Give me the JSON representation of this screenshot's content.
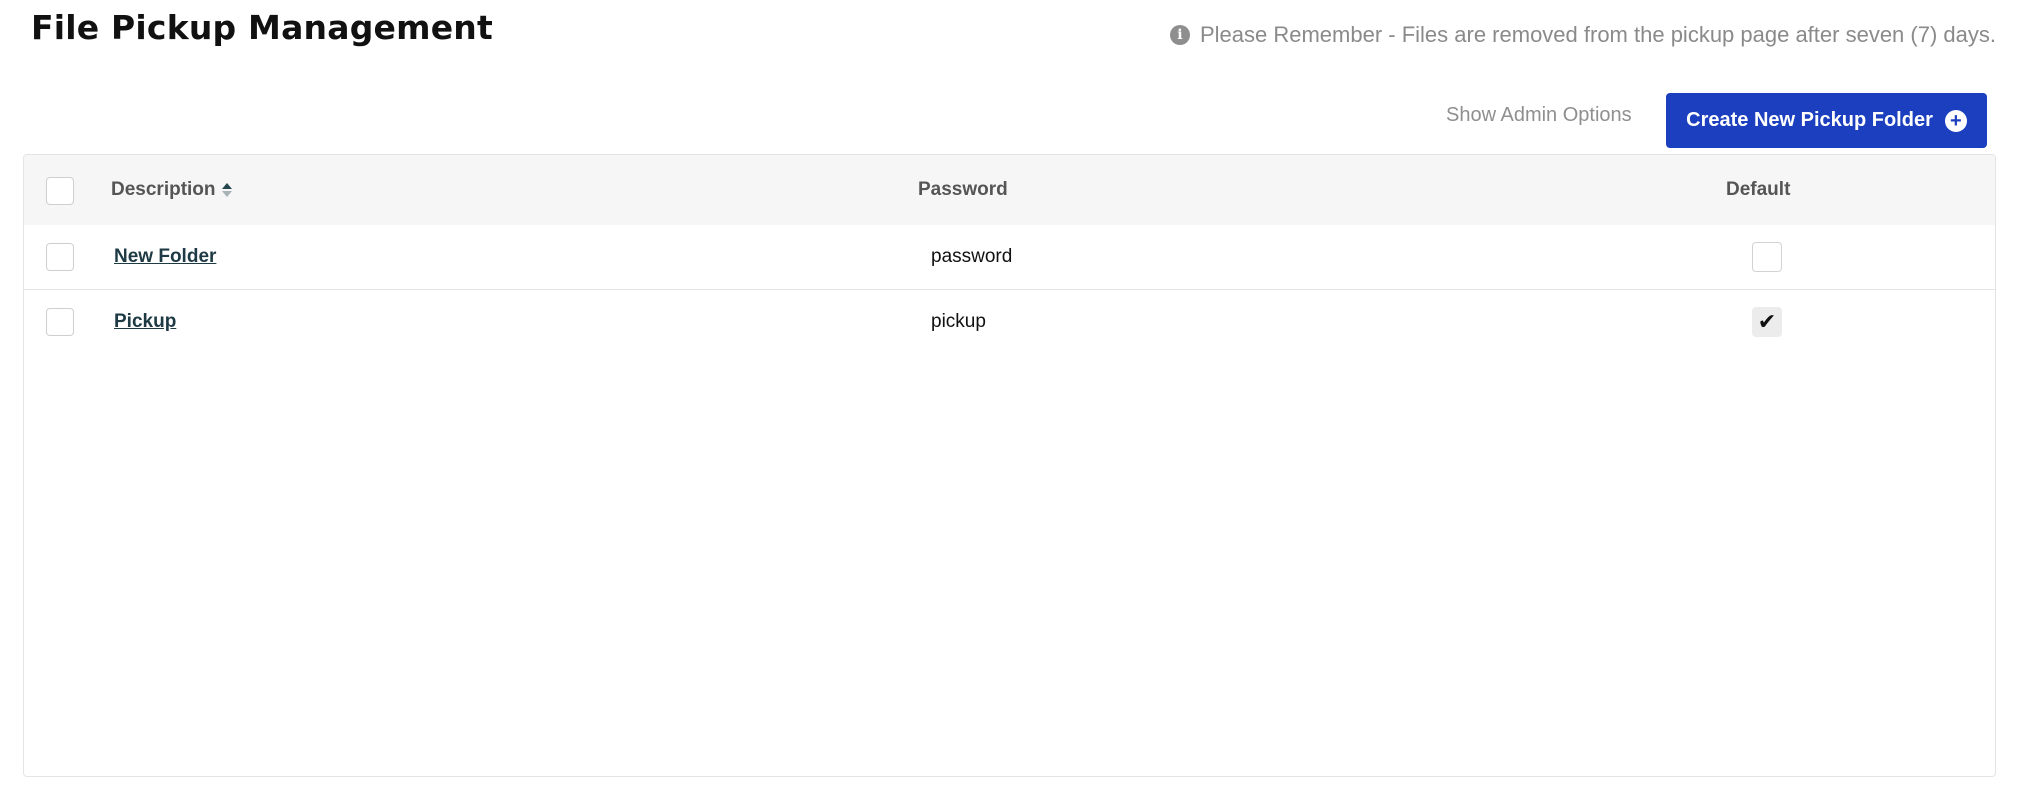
{
  "header": {
    "title": "File Pickup Management",
    "notice": "Please Remember - Files are removed from the pickup page after seven (7) days.",
    "notice_icon": "info-icon"
  },
  "toolbar": {
    "admin_options_label": "Show Admin Options",
    "create_button_label": "Create New Pickup Folder",
    "create_button_icon": "plus-circle-icon",
    "accent_color": "#1b3fbf"
  },
  "table": {
    "columns": {
      "description": "Description",
      "password": "Password",
      "default": "Default"
    },
    "sort": {
      "column": "Description",
      "direction": "ascending"
    },
    "rows": [
      {
        "description": "New Folder",
        "password": "password",
        "default": false,
        "default_mark": ""
      },
      {
        "description": "Pickup",
        "password": "pickup",
        "default": true,
        "default_mark": "✔"
      }
    ]
  }
}
